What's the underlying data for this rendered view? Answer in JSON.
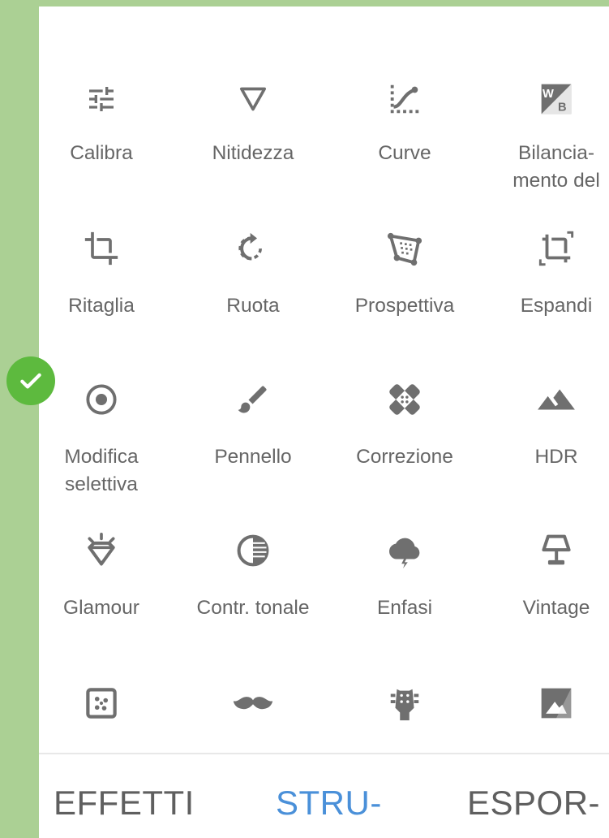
{
  "tools": [
    {
      "name": "calibra",
      "label": "Calibra",
      "icon": "tune-sliders-icon"
    },
    {
      "name": "nitidezza",
      "label": "Nitidezza",
      "icon": "triangle-down-icon"
    },
    {
      "name": "curve",
      "label": "Curve",
      "icon": "curve-icon"
    },
    {
      "name": "bilanciamento",
      "label": "Bilancia-\nmento del",
      "icon": "white-balance-icon"
    },
    {
      "name": "ritaglia",
      "label": "Ritaglia",
      "icon": "crop-icon"
    },
    {
      "name": "ruota",
      "label": "Ruota",
      "icon": "rotate-icon"
    },
    {
      "name": "prospettiva",
      "label": "Prospettiva",
      "icon": "perspective-icon"
    },
    {
      "name": "espandi",
      "label": "Espandi",
      "icon": "expand-icon"
    },
    {
      "name": "modifica-selettiva",
      "label": "Modifica\nselettiva",
      "icon": "selective-target-icon"
    },
    {
      "name": "pennello",
      "label": "Pennello",
      "icon": "brush-icon"
    },
    {
      "name": "correzione",
      "label": "Correzione",
      "icon": "bandage-icon"
    },
    {
      "name": "hdr",
      "label": "HDR",
      "icon": "mountains-icon"
    },
    {
      "name": "glamour",
      "label": "Glamour",
      "icon": "diamond-glow-icon"
    },
    {
      "name": "contr-tonale",
      "label": "Contr. tonale",
      "icon": "tonal-contrast-icon"
    },
    {
      "name": "enfasi",
      "label": "Enfasi",
      "icon": "storm-cloud-icon"
    },
    {
      "name": "vintage",
      "label": "Vintage",
      "icon": "lamp-icon"
    },
    {
      "name": "grana",
      "label": "",
      "icon": "grainy-film-icon"
    },
    {
      "name": "baffi",
      "label": "",
      "icon": "mustache-icon"
    },
    {
      "name": "chitarra",
      "label": "",
      "icon": "guitar-head-icon"
    },
    {
      "name": "bianco-nero",
      "label": "",
      "icon": "black-white-icon"
    }
  ],
  "tabs": {
    "effetti": "EFFETTI",
    "strumenti": "STRU-",
    "esporta": "ESPOR-"
  },
  "colors": {
    "background": "#abd094",
    "icon": "#6f6f6f",
    "label": "#666666",
    "active_tab": "#4a90d9",
    "inactive_tab": "#5f5f5f",
    "check_badge": "#5dba3e"
  }
}
